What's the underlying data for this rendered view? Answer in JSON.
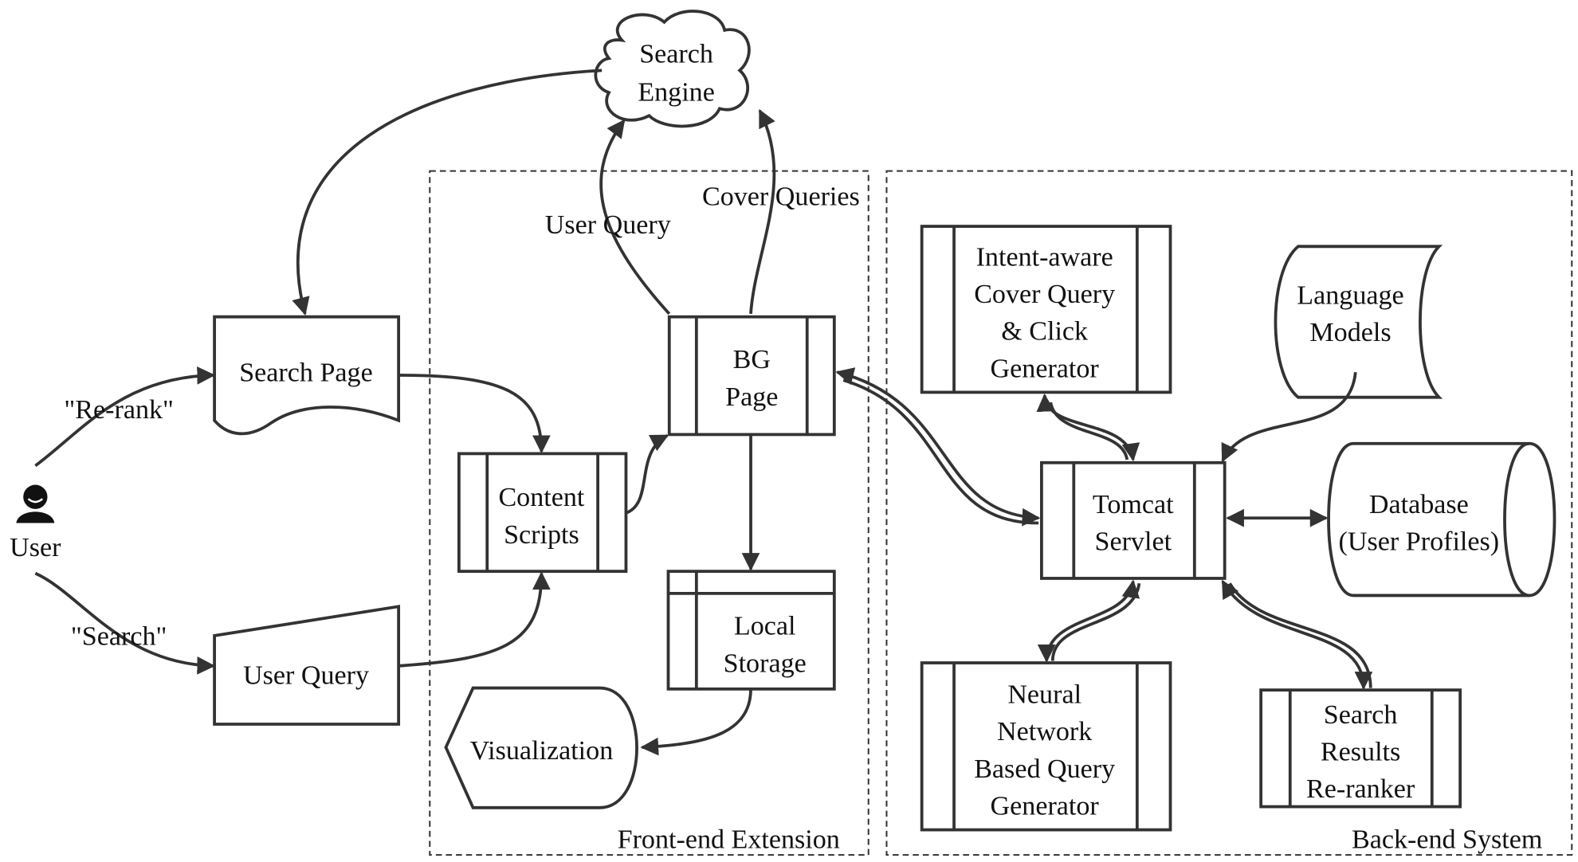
{
  "groups": {
    "frontend": "Front-end Extension",
    "backend": "Back-end System"
  },
  "nodes": {
    "search_engine": [
      "Search",
      "Engine"
    ],
    "user": "User",
    "search_page": "Search Page",
    "user_query_input": "User Query",
    "content_scripts": [
      "Content",
      "Scripts"
    ],
    "bg_page": [
      "BG",
      "Page"
    ],
    "local_storage": [
      "Local",
      "Storage"
    ],
    "visualization": "Visualization",
    "intent_aware": [
      "Intent-aware",
      "Cover Query",
      "& Click",
      "Generator"
    ],
    "language_models": [
      "Language",
      "Models"
    ],
    "tomcat": [
      "Tomcat",
      "Servlet"
    ],
    "database": [
      "Database",
      "(User Profiles)"
    ],
    "neural_network": [
      "Neural",
      "Network",
      "Based Query",
      "Generator"
    ],
    "reranker": [
      "Search",
      "Results",
      "Re-ranker"
    ]
  },
  "edge_labels": {
    "rerank": "\"Re-rank\"",
    "search": "\"Search\"",
    "user_query": "User Query",
    "cover_queries": "Cover Queries"
  },
  "colors": {
    "stroke": "#333333",
    "background": "#ffffff"
  }
}
